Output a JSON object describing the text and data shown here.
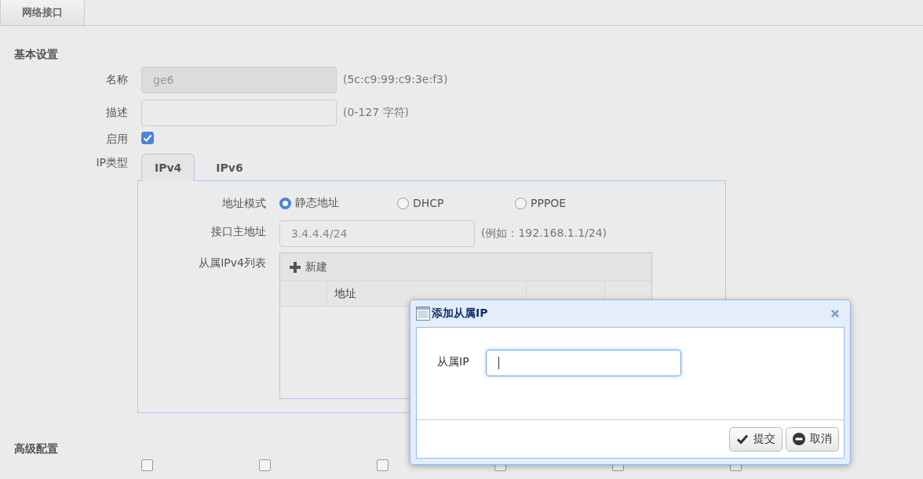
{
  "tabs": [
    {
      "label": "网络接口",
      "selected": true
    }
  ],
  "basic": {
    "title": "基本设置",
    "name": {
      "label": "名称",
      "value": "ge6",
      "disabled": true,
      "hint": "(5c:c9:99:c9:3e:f3)"
    },
    "description": {
      "label": "描述",
      "hint": "(0-127 字符)"
    },
    "enabled": {
      "label": "启用",
      "checked": true
    },
    "ip_type": {
      "label": "IP类型",
      "tabs": [
        {
          "label": "IPv4",
          "selected": true
        },
        {
          "label": "IPv6",
          "selected": false
        }
      ]
    }
  },
  "ipv4": {
    "mode": {
      "label": "地址模式",
      "options": [
        {
          "label": "静态地址",
          "selected": true
        },
        {
          "label": "DHCP",
          "selected": false
        },
        {
          "label": "PPPOE",
          "selected": false
        }
      ]
    },
    "primary": {
      "label": "接口主地址",
      "value": "3.4.4.4/24",
      "hint": "(例如：192.168.1.1/24)"
    },
    "secondary": {
      "label": "从属IPv4列表",
      "new_button": "新建",
      "columns": [
        "地址"
      ]
    }
  },
  "advanced": {
    "title": "高级配置",
    "options": [
      {
        "checked": false
      },
      {
        "checked": false
      },
      {
        "checked": false
      },
      {
        "checked": false
      },
      {
        "checked": false
      },
      {
        "checked": false
      }
    ]
  },
  "dialog": {
    "title": "添加从属IP",
    "field_label": "从属IP",
    "buttons": [
      {
        "kind": "submit",
        "label": "提交"
      },
      {
        "kind": "cancel",
        "label": "取消"
      }
    ]
  }
}
